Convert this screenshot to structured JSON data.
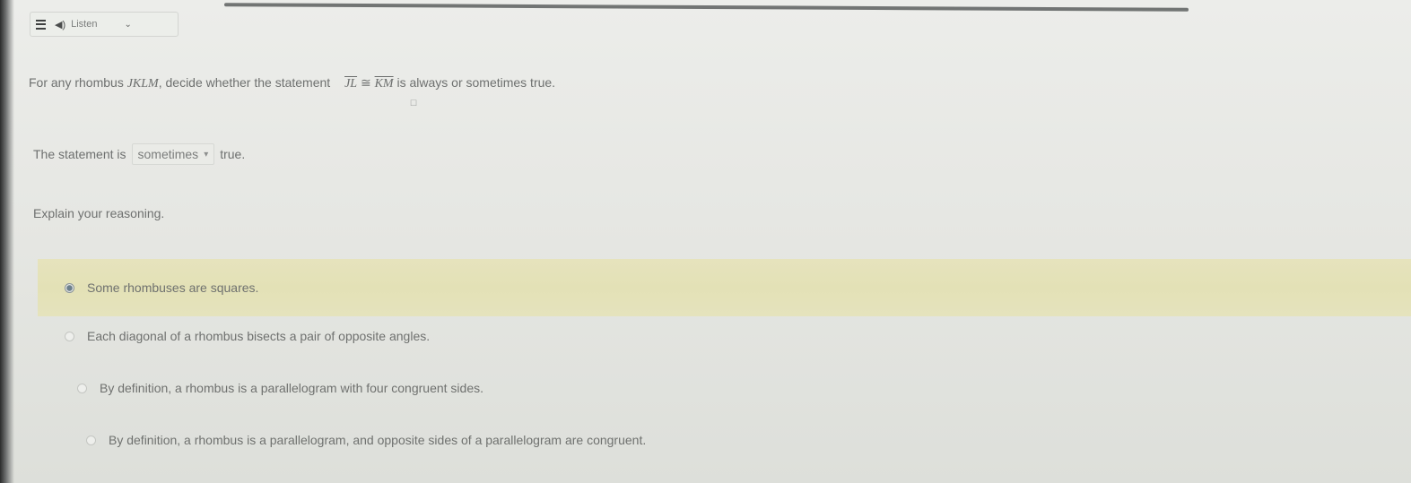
{
  "toolbar": {
    "listen_label": "Listen",
    "menu_icon": "menu-icon",
    "speaker_icon": "speaker-icon",
    "chevron_icon": "chevron-down-icon"
  },
  "question": {
    "prefix": "For any rhombus",
    "shape_name": "JKLM",
    "middle": ", decide whether the statement",
    "segment_a": "JL",
    "relation": "≅",
    "segment_b": "KM",
    "suffix": "is always or sometimes true."
  },
  "answer": {
    "prefix": "The statement is",
    "selected_value": "sometimes",
    "suffix": "true."
  },
  "explain_prompt": "Explain your reasoning.",
  "options": [
    {
      "label": "Some rhombuses are squares.",
      "selected": true
    },
    {
      "label": "Each diagonal of a rhombus bisects a pair of opposite angles.",
      "selected": false
    },
    {
      "label": "By definition, a rhombus is a parallelogram with four congruent sides.",
      "selected": false
    },
    {
      "label": "By definition, a rhombus is a parallelogram, and opposite sides of a parallelogram are congruent.",
      "selected": false
    }
  ],
  "colors": {
    "highlight": "#e4e2b9",
    "text": "#6f716f"
  }
}
